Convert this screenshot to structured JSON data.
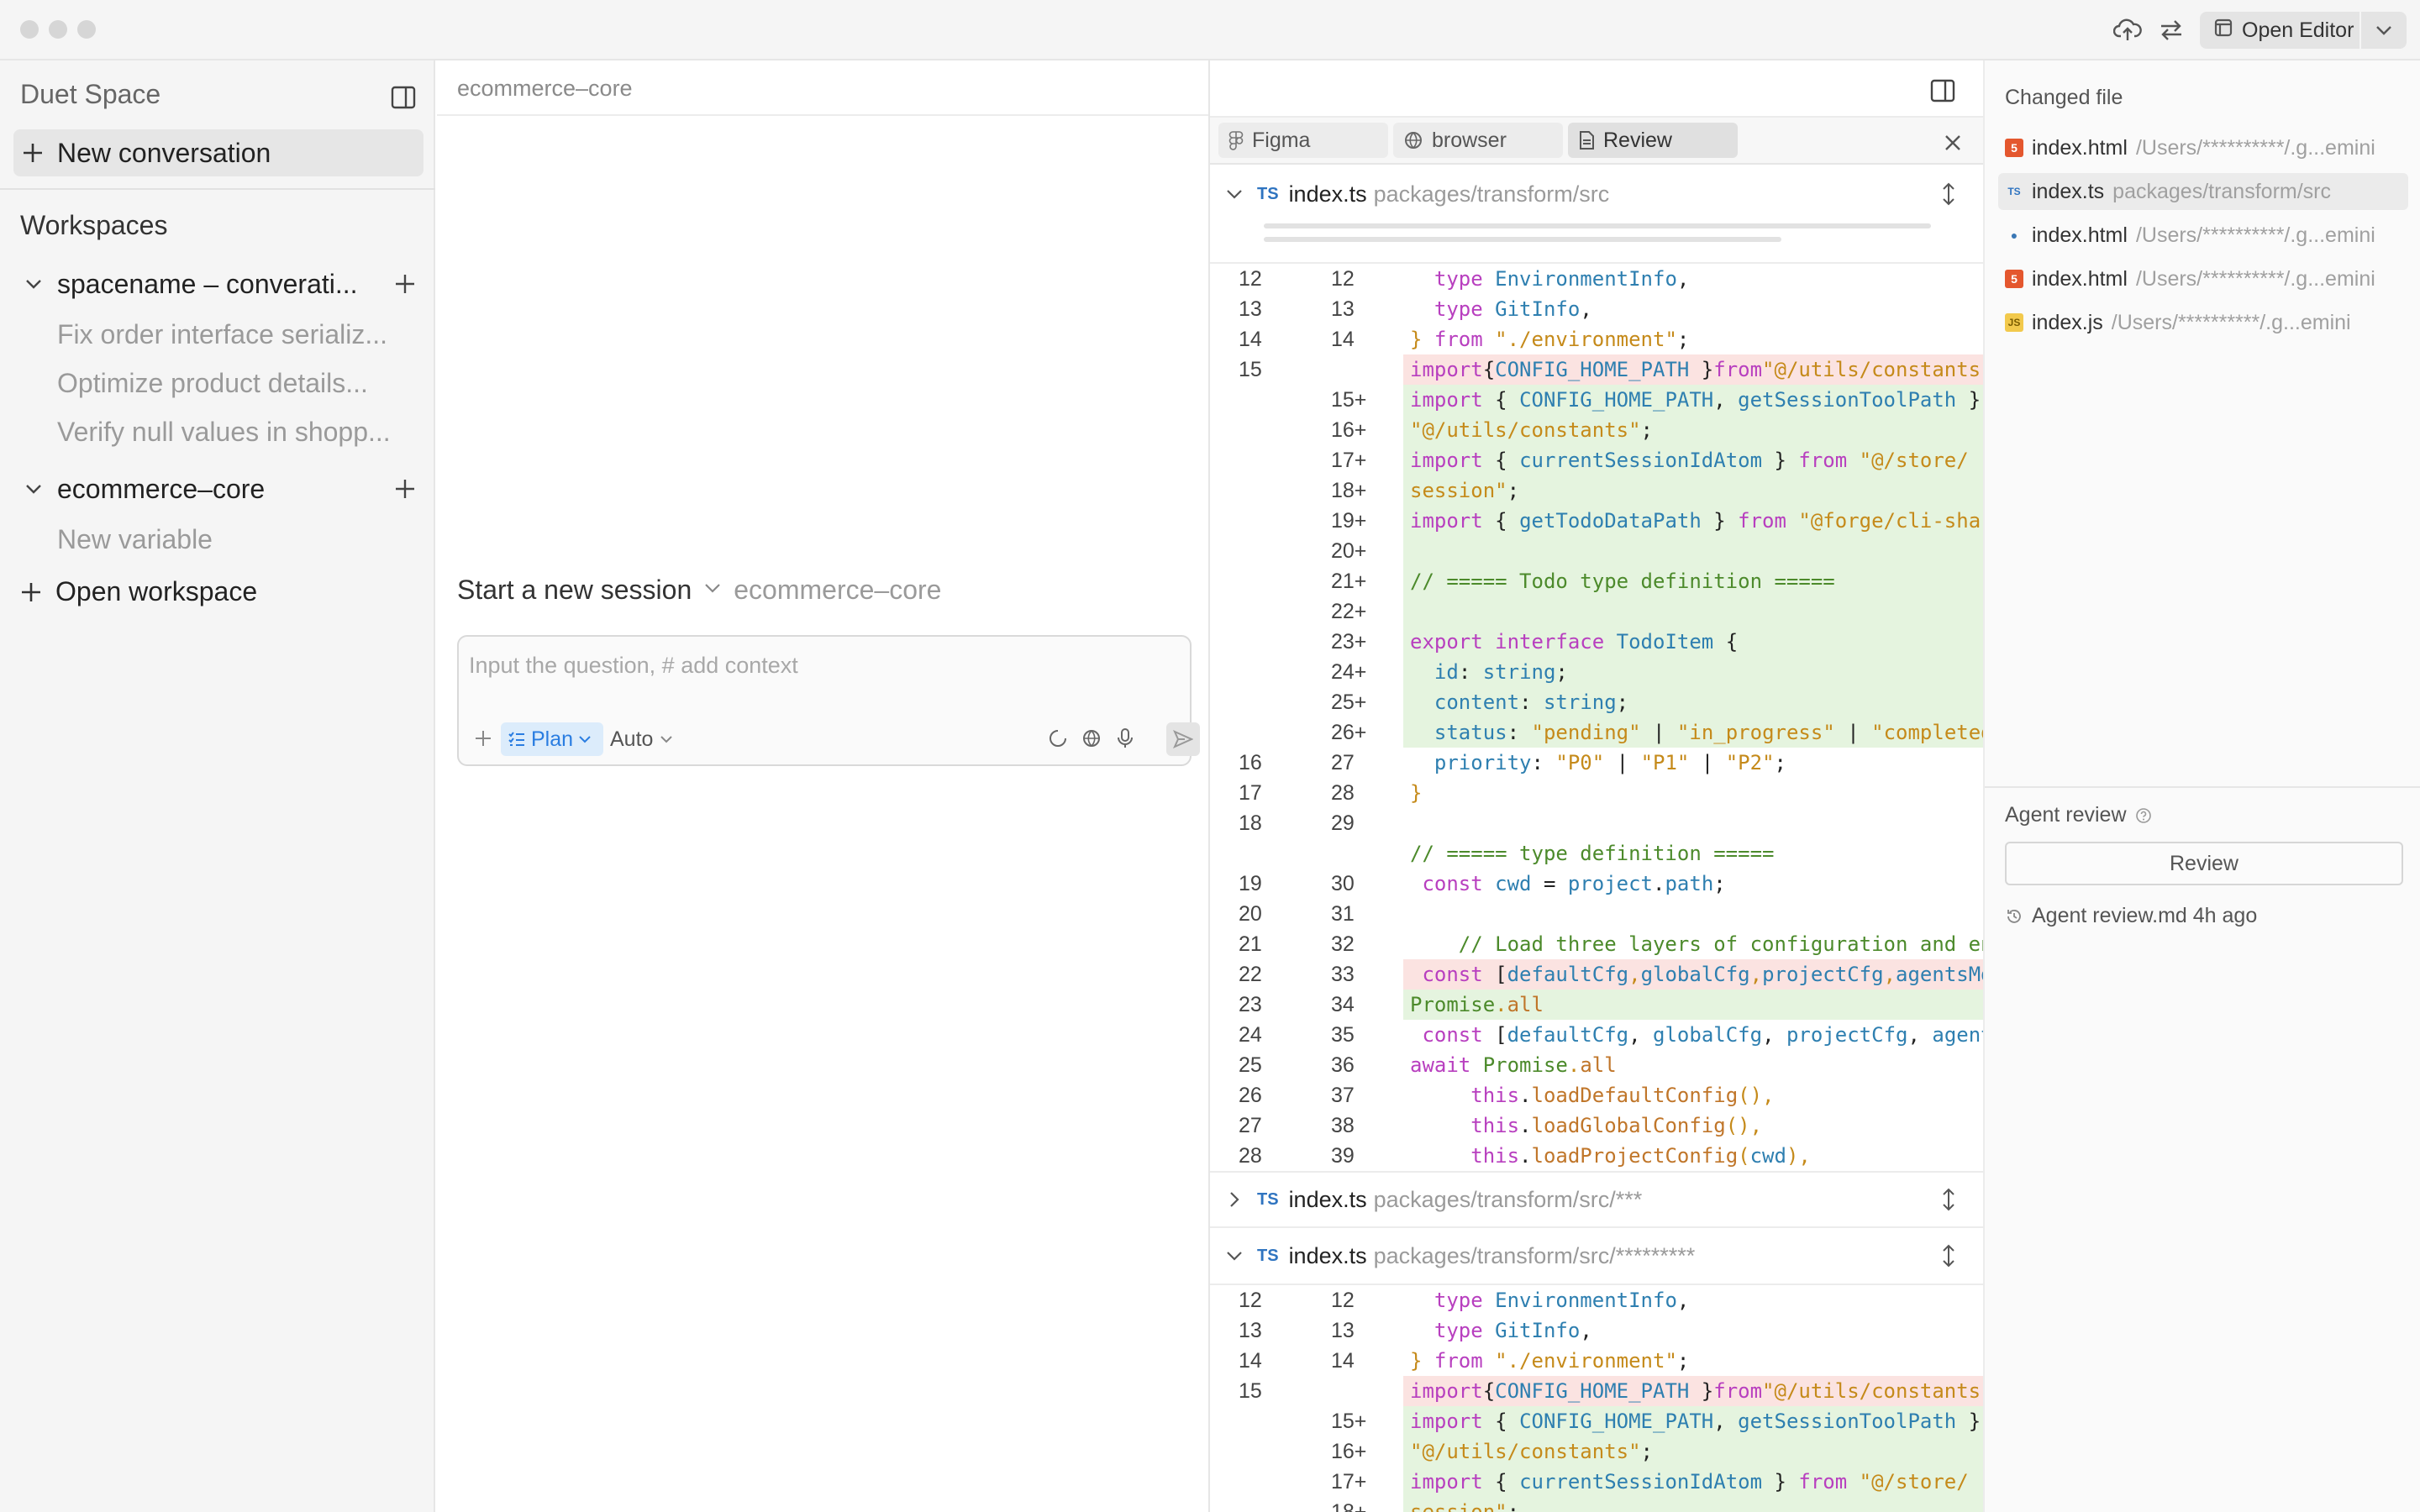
{
  "titlebar": {
    "open_editor_label": "Open Editor"
  },
  "sidebar": {
    "title": "Duet Space",
    "new_conversation_label": "New conversation",
    "workspaces_label": "Workspaces",
    "workspaces": [
      {
        "name": "spacename – converati...",
        "conversations": [
          "Fix order interface serializ...",
          "Optimize product details...",
          "Verify null values in shopp..."
        ]
      },
      {
        "name": "ecommerce–core",
        "conversations": [
          "New variable"
        ]
      }
    ],
    "open_workspace_label": "Open workspace"
  },
  "middle": {
    "breadcrumb": "ecommerce–core",
    "session_title": "Start a new session",
    "session_workspace": "ecommerce–core",
    "composer": {
      "placeholder": "Input the question, # add context",
      "plan_label": "Plan",
      "mode_label": "Auto"
    }
  },
  "review": {
    "tabs": [
      {
        "label": "Figma",
        "icon": "figma-icon"
      },
      {
        "label": "browser",
        "icon": "globe-icon"
      },
      {
        "label": "Review",
        "icon": "document-icon",
        "active": true
      }
    ],
    "files": [
      {
        "badge": "TS",
        "name": "index.ts",
        "path": "packages/transform/src",
        "expanded": true
      },
      {
        "badge": "TS",
        "name": "index.ts",
        "path": "packages/transform/src/***",
        "expanded": false
      },
      {
        "badge": "TS",
        "name": "index.ts",
        "path": "packages/transform/src/*********",
        "expanded": true
      }
    ],
    "diff_lines": [
      {
        "o": "12",
        "n": "12",
        "k": "",
        "segs": [
          [
            "pl",
            "  "
          ],
          [
            "kw",
            "type "
          ],
          [
            "ty",
            "EnvironmentInfo"
          ],
          [
            "pl",
            ","
          ]
        ]
      },
      {
        "o": "13",
        "n": "13",
        "k": "",
        "segs": [
          [
            "pl",
            "  "
          ],
          [
            "kw",
            "type "
          ],
          [
            "ty",
            "GitInfo"
          ],
          [
            "pl",
            ","
          ]
        ]
      },
      {
        "o": "14",
        "n": "14",
        "k": "",
        "segs": [
          [
            "st",
            "} "
          ],
          [
            "kw",
            "from "
          ],
          [
            "st",
            "\"./environment\""
          ],
          [
            "pl",
            ";"
          ]
        ]
      },
      {
        "o": "15",
        "n": "",
        "k": "del",
        "segs": [
          [
            "kw",
            "import"
          ],
          [
            "pl",
            "{"
          ],
          [
            "ty",
            "CONFIG_HOME_PATH "
          ],
          [
            "pl",
            "}"
          ],
          [
            "kw",
            "from"
          ],
          [
            "st",
            "\"@/utils/constants\""
          ]
        ]
      },
      {
        "o": "",
        "n": "15+",
        "k": "add",
        "segs": [
          [
            "kw",
            "import "
          ],
          [
            "pl",
            "{ "
          ],
          [
            "ty",
            "CONFIG_HOME_PATH"
          ],
          [
            "pl",
            ", "
          ],
          [
            "ty",
            "getSessionToolPath "
          ],
          [
            "pl",
            "}"
          ]
        ]
      },
      {
        "o": "",
        "n": "16+",
        "k": "add",
        "segs": [
          [
            "st",
            "\"@/utils/constants\""
          ],
          [
            "pl",
            ";"
          ]
        ]
      },
      {
        "o": "",
        "n": "17+",
        "k": "add",
        "segs": [
          [
            "kw",
            "import "
          ],
          [
            "pl",
            "{ "
          ],
          [
            "ty",
            "currentSessionIdAtom "
          ],
          [
            "pl",
            "} "
          ],
          [
            "kw",
            "from "
          ],
          [
            "st",
            "\"@/store/"
          ]
        ]
      },
      {
        "o": "",
        "n": "18+",
        "k": "add",
        "segs": [
          [
            "st",
            "session\""
          ],
          [
            "pl",
            ";"
          ]
        ]
      },
      {
        "o": "",
        "n": "19+",
        "k": "add",
        "segs": [
          [
            "kw",
            "import "
          ],
          [
            "pl",
            "{ "
          ],
          [
            "ty",
            "getTodoDataPath "
          ],
          [
            "pl",
            "} "
          ],
          [
            "kw",
            "from "
          ],
          [
            "st",
            "\"@forge/cli-shar"
          ]
        ]
      },
      {
        "o": "",
        "n": "20+",
        "k": "add",
        "segs": []
      },
      {
        "o": "",
        "n": "21+",
        "k": "add",
        "segs": [
          [
            "cm",
            "// ===== Todo type definition ====="
          ]
        ]
      },
      {
        "o": "",
        "n": "22+",
        "k": "add",
        "segs": []
      },
      {
        "o": "",
        "n": "23+",
        "k": "add",
        "segs": [
          [
            "kw",
            "export "
          ],
          [
            "kw",
            "interface "
          ],
          [
            "ty",
            "TodoItem "
          ],
          [
            "pl",
            "{"
          ]
        ]
      },
      {
        "o": "",
        "n": "24+",
        "k": "add",
        "segs": [
          [
            "pl",
            "  "
          ],
          [
            "id",
            "id"
          ],
          [
            "pl",
            ": "
          ],
          [
            "ty",
            "string"
          ],
          [
            "pl",
            ";"
          ]
        ]
      },
      {
        "o": "",
        "n": "25+",
        "k": "add",
        "segs": [
          [
            "pl",
            "  "
          ],
          [
            "id",
            "content"
          ],
          [
            "pl",
            ": "
          ],
          [
            "ty",
            "string"
          ],
          [
            "pl",
            ";"
          ]
        ]
      },
      {
        "o": "",
        "n": "26+",
        "k": "add",
        "segs": [
          [
            "pl",
            "  "
          ],
          [
            "id",
            "status"
          ],
          [
            "pl",
            ": "
          ],
          [
            "st",
            "\"pending\""
          ],
          [
            "pl",
            " | "
          ],
          [
            "st",
            "\"in_progress\""
          ],
          [
            "pl",
            " | "
          ],
          [
            "st",
            "\"completed"
          ]
        ]
      },
      {
        "o": "16",
        "n": "27",
        "k": "",
        "segs": [
          [
            "pl",
            "  "
          ],
          [
            "id",
            "priority"
          ],
          [
            "pl",
            ": "
          ],
          [
            "st",
            "\"P0\""
          ],
          [
            "pl",
            " | "
          ],
          [
            "st",
            "\"P1\""
          ],
          [
            "pl",
            " | "
          ],
          [
            "st",
            "\"P2\""
          ],
          [
            "pl",
            ";"
          ]
        ]
      },
      {
        "o": "17",
        "n": "28",
        "k": "",
        "segs": [
          [
            "st",
            "}"
          ]
        ]
      },
      {
        "o": "18",
        "n": "29",
        "k": "",
        "segs": []
      },
      {
        "o": "",
        "n": "",
        "k": "",
        "segs": [
          [
            "cm",
            "// ===== type definition ====="
          ]
        ]
      },
      {
        "o": "19",
        "n": "30",
        "k": "",
        "segs": [
          [
            "pl",
            " "
          ],
          [
            "kw",
            "const "
          ],
          [
            "id",
            "cwd "
          ],
          [
            "pl",
            "= "
          ],
          [
            "id",
            "project"
          ],
          [
            "pl",
            "."
          ],
          [
            "id",
            "path"
          ],
          [
            "pl",
            ";"
          ]
        ]
      },
      {
        "o": "20",
        "n": "31",
        "k": "",
        "segs": []
      },
      {
        "o": "21",
        "n": "32",
        "k": "",
        "segs": [
          [
            "pl",
            "    "
          ],
          [
            "cm",
            "// Load three layers of configuration and en"
          ]
        ]
      },
      {
        "o": "22",
        "n": "33",
        "k": "del",
        "segs": [
          [
            "pl",
            " "
          ],
          [
            "kw",
            "const "
          ],
          [
            "pl",
            "["
          ],
          [
            "id",
            "defaultCfg"
          ],
          [
            "st",
            ","
          ],
          [
            "id",
            "globalCfg"
          ],
          [
            "st",
            ","
          ],
          [
            "id",
            "projectCfg"
          ],
          [
            "st",
            ","
          ],
          [
            "id",
            "agentsMd"
          ]
        ]
      },
      {
        "o": "23",
        "n": "34",
        "k": "del2",
        "segs": [
          [
            "cm",
            "Promise"
          ],
          [
            "st",
            "."
          ],
          [
            "fn",
            "all"
          ]
        ]
      },
      {
        "o": "24",
        "n": "35",
        "k": "",
        "segs": [
          [
            "pl",
            " "
          ],
          [
            "kw",
            "const "
          ],
          [
            "pl",
            "["
          ],
          [
            "id",
            "defaultCfg"
          ],
          [
            "pl",
            ", "
          ],
          [
            "id",
            "globalCfg"
          ],
          [
            "pl",
            ", "
          ],
          [
            "id",
            "projectCfg"
          ],
          [
            "pl",
            ", "
          ],
          [
            "id",
            "agent"
          ]
        ]
      },
      {
        "o": "25",
        "n": "36",
        "k": "",
        "segs": [
          [
            "kw",
            "await "
          ],
          [
            "cm",
            "Promise"
          ],
          [
            "st",
            "."
          ],
          [
            "fn",
            "all"
          ]
        ]
      },
      {
        "o": "26",
        "n": "37",
        "k": "",
        "segs": [
          [
            "pl",
            "     "
          ],
          [
            "kw",
            "this"
          ],
          [
            "pl",
            "."
          ],
          [
            "fn",
            "loadDefaultConfig"
          ],
          [
            "st",
            "(),"
          ]
        ]
      },
      {
        "o": "27",
        "n": "38",
        "k": "",
        "segs": [
          [
            "pl",
            "     "
          ],
          [
            "kw",
            "this"
          ],
          [
            "pl",
            "."
          ],
          [
            "fn",
            "loadGlobalConfig"
          ],
          [
            "st",
            "(),"
          ]
        ]
      },
      {
        "o": "28",
        "n": "39",
        "k": "",
        "segs": [
          [
            "pl",
            "     "
          ],
          [
            "kw",
            "this"
          ],
          [
            "pl",
            "."
          ],
          [
            "fn",
            "loadProjectConfig"
          ],
          [
            "st",
            "("
          ],
          [
            "id",
            "cwd"
          ],
          [
            "st",
            "),"
          ]
        ]
      }
    ],
    "diff_lines_2": [
      {
        "o": "12",
        "n": "12",
        "k": "",
        "segs": [
          [
            "pl",
            "  "
          ],
          [
            "kw",
            "type "
          ],
          [
            "ty",
            "EnvironmentInfo"
          ],
          [
            "pl",
            ","
          ]
        ]
      },
      {
        "o": "13",
        "n": "13",
        "k": "",
        "segs": [
          [
            "pl",
            "  "
          ],
          [
            "kw",
            "type "
          ],
          [
            "ty",
            "GitInfo"
          ],
          [
            "pl",
            ","
          ]
        ]
      },
      {
        "o": "14",
        "n": "14",
        "k": "",
        "segs": [
          [
            "st",
            "} "
          ],
          [
            "kw",
            "from "
          ],
          [
            "st",
            "\"./environment\""
          ],
          [
            "pl",
            ";"
          ]
        ]
      },
      {
        "o": "15",
        "n": "",
        "k": "del",
        "segs": [
          [
            "kw",
            "import"
          ],
          [
            "pl",
            "{"
          ],
          [
            "ty",
            "CONFIG_HOME_PATH "
          ],
          [
            "pl",
            "}"
          ],
          [
            "kw",
            "from"
          ],
          [
            "st",
            "\"@/utils/constants\""
          ]
        ]
      },
      {
        "o": "",
        "n": "15+",
        "k": "add",
        "segs": [
          [
            "kw",
            "import "
          ],
          [
            "pl",
            "{ "
          ],
          [
            "ty",
            "CONFIG_HOME_PATH"
          ],
          [
            "pl",
            ", "
          ],
          [
            "ty",
            "getSessionToolPath "
          ],
          [
            "pl",
            "}"
          ]
        ]
      },
      {
        "o": "",
        "n": "16+",
        "k": "add",
        "segs": [
          [
            "st",
            "\"@/utils/constants\""
          ],
          [
            "pl",
            ";"
          ]
        ]
      },
      {
        "o": "",
        "n": "17+",
        "k": "add",
        "segs": [
          [
            "kw",
            "import "
          ],
          [
            "pl",
            "{ "
          ],
          [
            "ty",
            "currentSessionIdAtom "
          ],
          [
            "pl",
            "} "
          ],
          [
            "kw",
            "from "
          ],
          [
            "st",
            "\"@/store/"
          ]
        ]
      },
      {
        "o": "",
        "n": "18+",
        "k": "add",
        "segs": [
          [
            "st",
            "session\""
          ],
          [
            "pl",
            ";"
          ]
        ]
      }
    ]
  },
  "right_panel": {
    "changed_file_label": "Changed file",
    "changed_files": [
      {
        "icon": "html-icon",
        "name": "index.html",
        "path": "/Users/**********/.g...emini"
      },
      {
        "icon": "ts-icon",
        "name": "index.ts",
        "path": "packages/transform/src",
        "selected": true
      },
      {
        "icon": "python-icon",
        "name": "index.html",
        "path": "/Users/**********/.g...emini"
      },
      {
        "icon": "html-icon",
        "name": "index.html",
        "path": "/Users/**********/.g...emini"
      },
      {
        "icon": "js-icon",
        "name": "index.js",
        "path": "/Users/**********/.g...emini"
      }
    ],
    "agent_review_label": "Agent review",
    "review_button_label": "Review",
    "history_label": "Agent review.md 4h ago"
  }
}
